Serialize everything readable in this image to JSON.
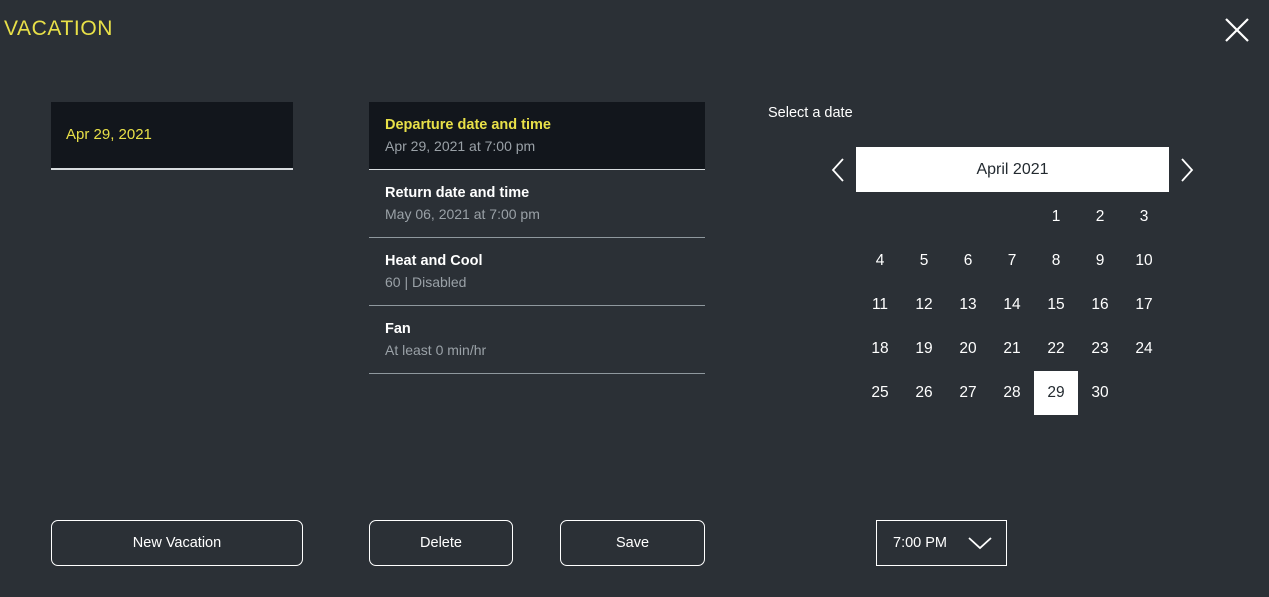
{
  "header": {
    "title": "VACATION",
    "close_icon": "close-icon"
  },
  "vacation_card": {
    "label": "Apr 29, 2021"
  },
  "settings": {
    "rows": [
      {
        "title": "Departure date and time",
        "value": "Apr 29, 2021 at 7:00 pm",
        "selected": true
      },
      {
        "title": "Return date and time",
        "value": "May 06, 2021 at 7:00 pm",
        "selected": false
      },
      {
        "title": "Heat and Cool",
        "value": "60 | Disabled",
        "selected": false
      },
      {
        "title": "Fan",
        "value": "At least 0 min/hr",
        "selected": false
      }
    ]
  },
  "calendar": {
    "section_label": "Select a date",
    "prev_icon": "chevron-left-icon",
    "next_icon": "chevron-right-icon",
    "month_label": "April 2021",
    "leading_blanks": 4,
    "days": [
      1,
      2,
      3,
      4,
      5,
      6,
      7,
      8,
      9,
      10,
      11,
      12,
      13,
      14,
      15,
      16,
      17,
      18,
      19,
      20,
      21,
      22,
      23,
      24,
      25,
      26,
      27,
      28,
      29,
      30
    ],
    "selected_day": 29
  },
  "actions": {
    "new_vacation": "New Vacation",
    "delete": "Delete",
    "save": "Save"
  },
  "time_select": {
    "value": "7:00 PM",
    "chevron_icon": "chevron-down-icon"
  },
  "colors": {
    "background": "#2b3036",
    "accent_yellow": "#e8e048",
    "panel_dark": "#12161c",
    "text_primary": "#ffffff",
    "text_secondary": "#9aa1a7",
    "highlight": "#ffffff"
  }
}
